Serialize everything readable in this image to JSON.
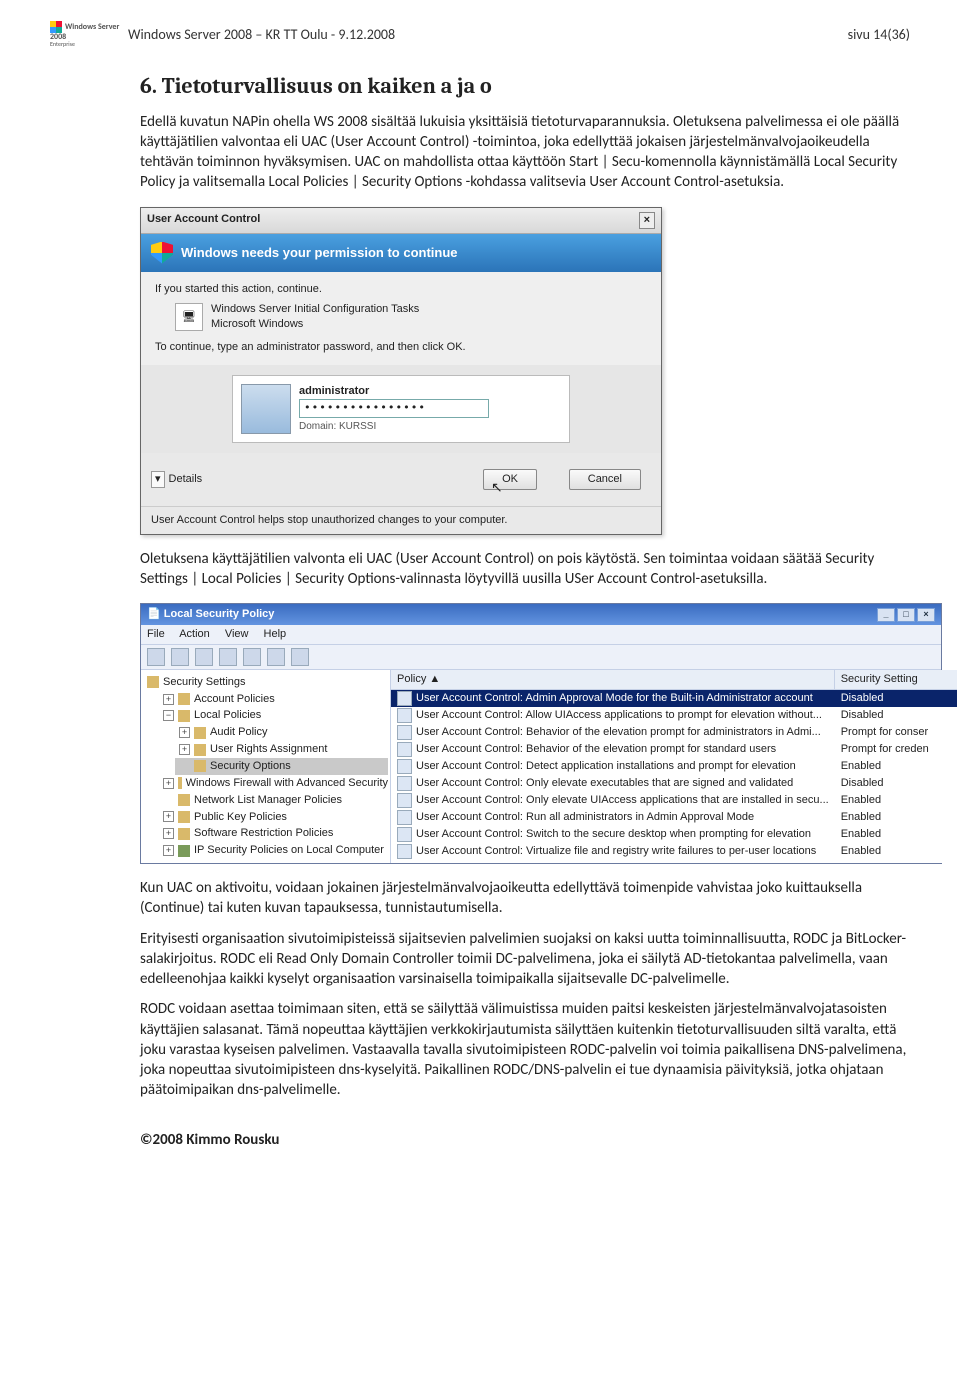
{
  "header": {
    "doc_title": "Windows Server 2008 – KR TT Oulu - 9.12.2008",
    "page_info": "sivu 14(36)",
    "logo_line1": "Windows Server 2008",
    "logo_line2": "Enterprise"
  },
  "section": {
    "num_title": "6. Tietoturvallisuus on kaiken a ja o"
  },
  "paragraphs": {
    "p1": "Edellä kuvatun NAPin ohella WS 2008 sisältää lukuisia yksittäisiä tietoturvaparannuksia. Oletuksena palvelimessa ei ole päällä käyttäjätilien valvontaa eli UAC (User Account Control) -toimintoa, joka edellyttää jokaisen järjestelmänvalvojaoikeudella tehtävän toiminnon hyväksymisen. UAC on mahdollista ottaa käyttöön Start | Secu-komennolla käynnistämällä Local Security Policy ja valitsemalla Local Policies | Security Options -kohdassa valitsevia User Account Control-asetuksia.",
    "p2": "Oletuksena käyttäjätilien valvonta eli UAC (User Account Control) on pois käytöstä. Sen toimintaa voidaan säätää Security Settings | Local Policies | Security Options-valinnasta löytyvillä uusilla USer Account Control-asetuksilla.",
    "p3": "Kun UAC on aktivoitu, voidaan jokainen järjestelmänvalvojaoikeutta edellyttävä toimenpide vahvistaa joko kuittauksella (Continue) tai kuten kuvan tapauksessa, tunnistautumisella.",
    "p4": "Erityisesti organisaation sivutoimipisteissä sijaitsevien palvelimien suojaksi on kaksi uutta toiminnallisuutta, RODC ja BitLocker-salakirjoitus. RODC eli Read Only Domain Controller toimii DC-palvelimena, joka ei säilytä AD-tietokantaa palvelimella, vaan edelleenohjaa kaikki kyselyt organisaation varsinaisella toimipaikalla sijaitsevalle DC-palvelimelle.",
    "p5": "RODC voidaan asettaa toimimaan siten, että se säilyttää välimuistissa muiden paitsi keskeisten järjestelmänvalvojatasoisten käyttäjien salasanat. Tämä nopeuttaa käyttäjien verkkokirjautumista säilyttäen kuitenkin tietoturvallisuuden siltä varalta, että joku varastaa kyseisen palvelimen. Vastaavalla tavalla sivutoimipisteen RODC-palvelin voi toimia paikallisena DNS-palvelimena, joka nopeuttaa sivutoimipisteen dns-kyselyitä. Paikallinen RODC/DNS-palvelin ei tue dynaamisia päivityksiä, jotka ohjataan päätoimipaikan dns-palvelimelle."
  },
  "uac": {
    "title": "User Account Control",
    "band": "Windows needs your permission to continue",
    "started": "If you started this action, continue.",
    "prog_name": "Windows Server Initial Configuration Tasks",
    "prog_vendor": "Microsoft Windows",
    "instr": "To continue, type an administrator password, and then click OK.",
    "user": "administrator",
    "pw_masked": "••••••••••••••••",
    "domain": "Domain: KURSSI",
    "details": "Details",
    "ok": "OK",
    "cancel": "Cancel",
    "foot": "User Account Control helps stop unauthorized changes to your computer."
  },
  "lsp": {
    "title": "Local Security Policy",
    "menu": {
      "file": "File",
      "action": "Action",
      "view": "View",
      "help": "Help"
    },
    "tree": {
      "root": "Security Settings",
      "items": [
        "Account Policies",
        "Local Policies",
        "Audit Policy",
        "User Rights Assignment",
        "Security Options",
        "Windows Firewall with Advanced Security",
        "Network List Manager Policies",
        "Public Key Policies",
        "Software Restriction Policies",
        "IP Security Policies on Local Computer"
      ]
    },
    "list_header": {
      "c1": "Policy  ▲",
      "c2": "Security Setting"
    },
    "rows": [
      {
        "p": "User Account Control: Admin Approval Mode for the Built-in Administrator account",
        "s": "Disabled",
        "sel": true
      },
      {
        "p": "User Account Control: Allow UIAccess applications to prompt for elevation without...",
        "s": "Disabled"
      },
      {
        "p": "User Account Control: Behavior of the elevation prompt for administrators in Admi...",
        "s": "Prompt for conser"
      },
      {
        "p": "User Account Control: Behavior of the elevation prompt for standard users",
        "s": "Prompt for creden"
      },
      {
        "p": "User Account Control: Detect application installations and prompt for elevation",
        "s": "Enabled"
      },
      {
        "p": "User Account Control: Only elevate executables that are signed and validated",
        "s": "Disabled"
      },
      {
        "p": "User Account Control: Only elevate UIAccess applications that are installed in secu...",
        "s": "Enabled"
      },
      {
        "p": "User Account Control: Run all administrators in Admin Approval Mode",
        "s": "Enabled"
      },
      {
        "p": "User Account Control: Switch to the secure desktop when prompting for elevation",
        "s": "Enabled"
      },
      {
        "p": "User Account Control: Virtualize file and registry write failures to per-user locations",
        "s": "Enabled"
      }
    ]
  },
  "footer": {
    "copyright": "©2008 Kimmo Rousku"
  }
}
